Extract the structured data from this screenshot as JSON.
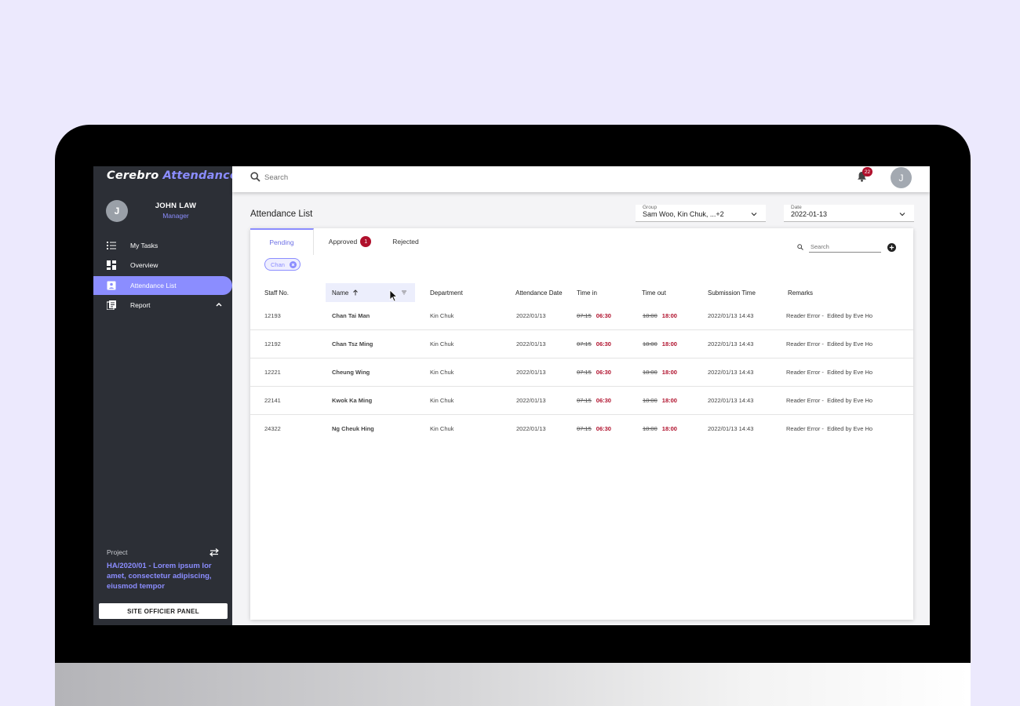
{
  "app": {
    "logo_part1": "Cerebro",
    "logo_part2": "Attendance"
  },
  "user": {
    "initial": "J",
    "name": "JOHN LAW",
    "role": "Manager"
  },
  "sidebar": {
    "items": [
      {
        "label": "My Tasks",
        "icon": "task-list-icon"
      },
      {
        "label": "Overview",
        "icon": "dashboard-icon"
      },
      {
        "label": "Attendance List",
        "icon": "contact-card-icon",
        "active": true
      },
      {
        "label": "Report",
        "icon": "report-icon",
        "expandable": true
      }
    ],
    "project_label": "Project",
    "project_text": "HA/2020/01 - Lorem ipsum lor amet, consectetur adipiscing, eiusmod tempor",
    "panel_button": "SITE OFFICIER PANEL"
  },
  "topbar": {
    "search_placeholder": "Search",
    "notification_count": "22",
    "avatar_initial": "J"
  },
  "header": {
    "title": "Attendance List",
    "group_label": "Group",
    "group_value": "Sam Woo, Kin Chuk, ...+2",
    "date_label": "Date",
    "date_value": "2022-01-13"
  },
  "tabs": [
    {
      "label": "Pending",
      "active": true
    },
    {
      "label": "Approved",
      "badge": "1"
    },
    {
      "label": "Rejected"
    }
  ],
  "card": {
    "search_placeholder": "Search",
    "chip": "Chan"
  },
  "table": {
    "columns": [
      "Staff No.",
      "Name",
      "Department",
      "Attendance Date",
      "Time in",
      "Time out",
      "Submission Time",
      "Remarks"
    ],
    "rows": [
      {
        "staff_no": "12193",
        "name": "Chan Tai Man",
        "department": "Kin Chuk",
        "date": "2022/01/13",
        "time_in_old": "07:15",
        "time_in_new": "06:30",
        "time_out_old": "18:00",
        "time_out_new": "18:00",
        "submission": "2022/01/13 14:43",
        "remarks": "Reader Error -  Edited by Eve Ho"
      },
      {
        "staff_no": "12192",
        "name": "Chan Tsz Ming",
        "department": "Kin Chuk",
        "date": "2022/01/13",
        "time_in_old": "07:15",
        "time_in_new": "06:30",
        "time_out_old": "18:00",
        "time_out_new": "18:00",
        "submission": "2022/01/13 14:43",
        "remarks": "Reader Error -  Edited by Eve Ho"
      },
      {
        "staff_no": "12221",
        "name": "Cheung Wing",
        "department": "Kin Chuk",
        "date": "2022/01/13",
        "time_in_old": "07:15",
        "time_in_new": "06:30",
        "time_out_old": "18:00",
        "time_out_new": "18:00",
        "submission": "2022/01/13 14:43",
        "remarks": "Reader Error -  Edited by Eve Ho"
      },
      {
        "staff_no": "22141",
        "name": "Kwok Ka Ming",
        "department": "Kin Chuk",
        "date": "2022/01/13",
        "time_in_old": "07:15",
        "time_in_new": "06:30",
        "time_out_old": "18:00",
        "time_out_new": "18:00",
        "submission": "2022/01/13 14:43",
        "remarks": "Reader Error -  Edited by Eve Ho"
      },
      {
        "staff_no": "24322",
        "name": "Ng Cheuk Hing",
        "department": "Kin Chuk",
        "date": "2022/01/13",
        "time_in_old": "07:15",
        "time_in_new": "06:30",
        "time_out_old": "18:00",
        "time_out_new": "18:00",
        "submission": "2022/01/13 14:43",
        "remarks": "Reader Error -  Edited by Eve Ho"
      }
    ]
  },
  "colors": {
    "accent": "#8b8dff",
    "sidebar_bg": "#2c2f36",
    "alert": "#b0102c",
    "page_bg": "#ece9fd"
  }
}
